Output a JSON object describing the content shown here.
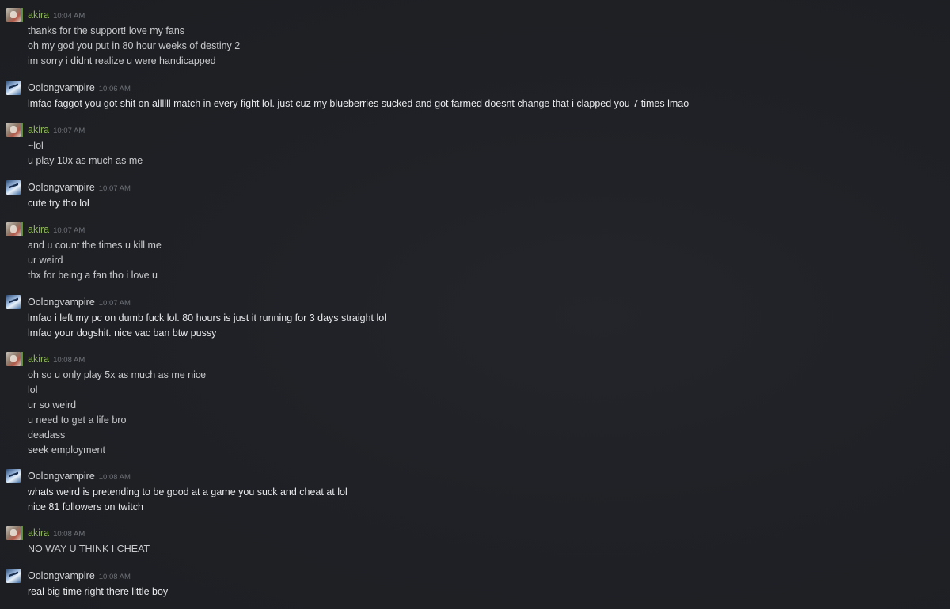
{
  "chat": {
    "messages": [
      {
        "author": "akira",
        "time": "10:04 AM",
        "lines": [
          "thanks for the support! love my fans",
          "oh my god you put in 80 hour weeks of destiny 2",
          "im sorry i didnt realize u were handicapped"
        ]
      },
      {
        "author": "Oolongvampire",
        "time": "10:06 AM",
        "lines": [
          "lmfao faggot you got shit on allllll match in every fight lol. just cuz my blueberries sucked and got farmed doesnt change that i clapped you 7 times lmao"
        ]
      },
      {
        "author": "akira",
        "time": "10:07 AM",
        "lines": [
          "~lol",
          "u play 10x as much as me"
        ]
      },
      {
        "author": "Oolongvampire",
        "time": "10:07 AM",
        "lines": [
          "cute try tho lol"
        ]
      },
      {
        "author": "akira",
        "time": "10:07 AM",
        "lines": [
          "and u count the times u kill me",
          "ur weird",
          "thx for being a fan tho i love u"
        ]
      },
      {
        "author": "Oolongvampire",
        "time": "10:07 AM",
        "lines": [
          "lmfao i left my pc on dumb fuck lol. 80 hours is just it running for 3 days straight lol",
          "lmfao your dogshit. nice vac ban btw pussy"
        ]
      },
      {
        "author": "akira",
        "time": "10:08 AM",
        "lines": [
          "oh so u only play 5x as much as me nice",
          "lol",
          "ur so weird",
          "u need to get a life bro",
          "deadass",
          "seek employment"
        ]
      },
      {
        "author": "Oolongvampire",
        "time": "10:08 AM",
        "lines": [
          "whats weird is pretending to be good at a game you suck and cheat at lol",
          "nice 81 followers on twitch"
        ]
      },
      {
        "author": "akira",
        "time": "10:08 AM",
        "lines": [
          "NO WAY U THINK I CHEAT"
        ]
      },
      {
        "author": "Oolongvampire",
        "time": "10:08 AM",
        "lines": [
          "real big time right there little boy"
        ]
      }
    ]
  },
  "colors": {
    "background": "#1e2025",
    "akira_name": "#8fb857",
    "oolong_name": "#d6d7d9",
    "timestamp": "#6e7178",
    "online_indicator": "#6a8f3a"
  }
}
